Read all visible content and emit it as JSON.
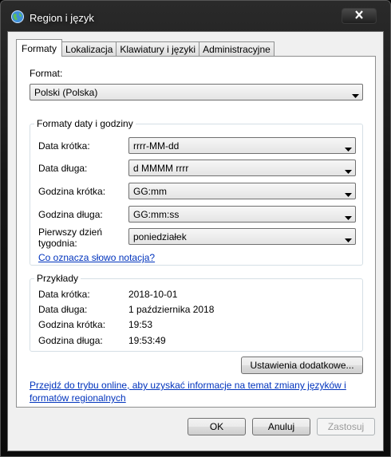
{
  "window": {
    "title": "Region i język"
  },
  "tabs": [
    {
      "label": "Formaty",
      "active": true
    },
    {
      "label": "Lokalizacja"
    },
    {
      "label": "Klawiatury i języki"
    },
    {
      "label": "Administracyjne"
    }
  ],
  "format": {
    "label": "Format:",
    "value": "Polski (Polska)"
  },
  "date_time": {
    "title": "Formaty daty i godziny",
    "rows": [
      {
        "label": "Data krótka:",
        "value": "rrrr-MM-dd"
      },
      {
        "label": "Data długa:",
        "value": "d MMMM rrrr"
      },
      {
        "label": "Godzina krótka:",
        "value": "GG:mm"
      },
      {
        "label": "Godzina długa:",
        "value": "GG:mm:ss"
      },
      {
        "label": "Pierwszy dzień",
        "label2": "tygodnia:",
        "value": "poniedziałek"
      }
    ],
    "notation_link": "Co oznacza słowo notacja?"
  },
  "examples": {
    "title": "Przykłady",
    "rows": [
      {
        "label": "Data krótka:",
        "value": "2018-10-01"
      },
      {
        "label": "Data długa:",
        "value": "1 października 2018"
      },
      {
        "label": "Godzina krótka:",
        "value": "19:53"
      },
      {
        "label": "Godzina długa:",
        "value": "19:53:49"
      }
    ]
  },
  "additional_settings_button": "Ustawienia dodatkowe...",
  "online_link": {
    "line1": "Przejdź do trybu online, aby uzyskać informacje na temat zmiany języków i",
    "line2": "formatów regionalnych"
  },
  "footer": {
    "ok": "OK",
    "cancel": "Anuluj",
    "apply": "Zastosuj"
  },
  "icons": {
    "app": "globe-icon",
    "close": "close-icon",
    "dropdown": "chevron-down-icon"
  }
}
